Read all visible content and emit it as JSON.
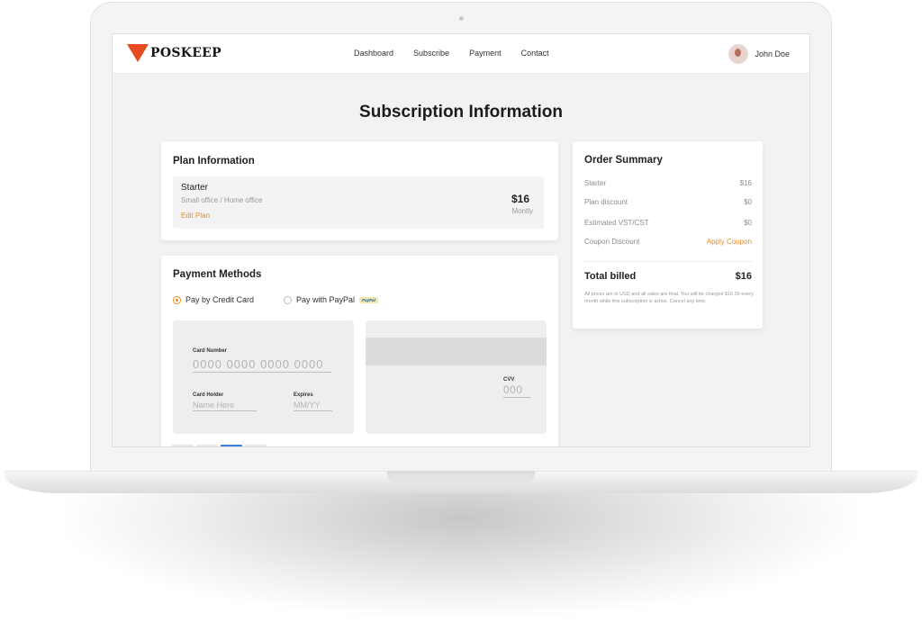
{
  "brand": {
    "name": "POSKEEP",
    "accent": "#e84a23"
  },
  "nav": {
    "items": [
      "Dashboard",
      "Subscribe",
      "Payment",
      "Contact"
    ]
  },
  "user": {
    "name": "John Doe"
  },
  "page": {
    "title": "Subscription Information"
  },
  "plan": {
    "section_title": "Plan Information",
    "name": "Starter",
    "description": "Small office / Home office",
    "edit_label": "Edit Plan",
    "price": "$16",
    "period": "Montly"
  },
  "payment": {
    "section_title": "Payment Methods",
    "options": [
      {
        "label": "Pay by Credit Card",
        "selected": true
      },
      {
        "label": "Pay with PayPal",
        "selected": false
      }
    ],
    "paypal_badge": "PayPal",
    "card": {
      "number_label": "Card Number",
      "number_placeholder": "0000 0000 0000 0000",
      "holder_label": "Card Holder",
      "holder_placeholder": "Name Here",
      "expires_label": "Expires",
      "expires_placeholder": "MM/YY",
      "cvv_label": "CVV",
      "cvv_placeholder": "000"
    }
  },
  "summary": {
    "title": "Order Summary",
    "rows": [
      {
        "label": "Starter",
        "value": "$16"
      },
      {
        "label": "Plan discount",
        "value": "$0"
      },
      {
        "label": "Estimated VST/CST",
        "value": "$0"
      },
      {
        "label": "Coupon Discount",
        "value": "Apply Coupon"
      }
    ],
    "total_label": "Total billed",
    "total_value": "$16",
    "note": "All prices are in USD and all sales are final. You will be charged $16.00 every month while this subscription is active. Cancel any time."
  },
  "colors": {
    "accent": "#f08a1d",
    "active_page": "#3d7de0"
  }
}
